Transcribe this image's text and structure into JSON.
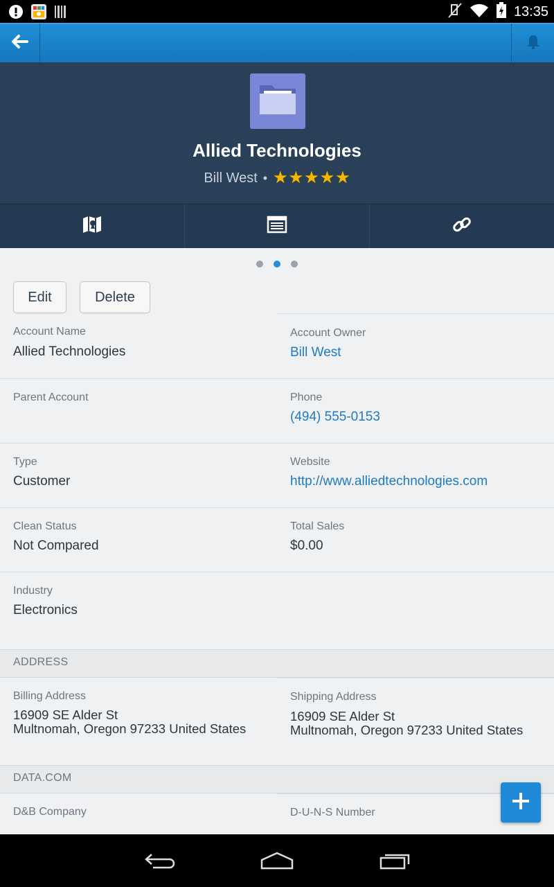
{
  "status_bar": {
    "time": "13:35",
    "icons": [
      "alert-icon",
      "notification-app-icon",
      "barcode-icon",
      "mute-icon",
      "wifi-icon",
      "battery-icon"
    ]
  },
  "topbar": {
    "back_icon": "arrow-left-icon",
    "bell_icon": "bell-icon"
  },
  "header": {
    "icon": "folder-icon",
    "title": "Allied Technologies",
    "owner": "Bill West",
    "separator": "•",
    "rating": 5,
    "stars": [
      "★",
      "★",
      "★",
      "★",
      "★"
    ],
    "tile_color": "#7a87d6"
  },
  "actions": [
    {
      "name": "map-icon"
    },
    {
      "name": "news-feed-icon"
    },
    {
      "name": "link-icon"
    }
  ],
  "pager": {
    "pages": 3,
    "active_index": 1
  },
  "buttons": {
    "edit": "Edit",
    "delete": "Delete"
  },
  "fields": {
    "account_name_label": "Account Name",
    "account_name": "Allied Technologies",
    "account_owner_label": "Account Owner",
    "account_owner": "Bill West",
    "parent_account_label": "Parent Account",
    "parent_account": "",
    "phone_label": "Phone",
    "phone": "(494) 555-0153",
    "type_label": "Type",
    "type": "Customer",
    "website_label": "Website",
    "website": "http://www.alliedtechnologies.com",
    "clean_status_label": "Clean Status",
    "clean_status": "Not Compared",
    "total_sales_label": "Total Sales",
    "total_sales": "$0.00",
    "industry_label": "Industry",
    "industry": "Electronics"
  },
  "address": {
    "section_title": "ADDRESS",
    "billing_label": "Billing Address",
    "billing_line1": "16909 SE Alder St",
    "billing_line2": "Multnomah, Oregon 97233 United States",
    "shipping_label": "Shipping Address",
    "shipping_line1": "16909 SE Alder St",
    "shipping_line2": "Multnomah, Oregon 97233 United States"
  },
  "datacom": {
    "section_title": "DATA.COM",
    "dnb_company_label": "D&B Company",
    "duns_label": "D-U-N-S Number"
  },
  "fab": {
    "icon": "plus-icon"
  },
  "navbar": {
    "icons": [
      "back-nav-icon",
      "home-nav-icon",
      "recents-nav-icon"
    ]
  },
  "colors": {
    "topbar": "#1f8fd7",
    "header_bg": "#2a4058",
    "link": "#1e7ac2",
    "star": "#f5b800",
    "fab": "#1f8ad8"
  }
}
